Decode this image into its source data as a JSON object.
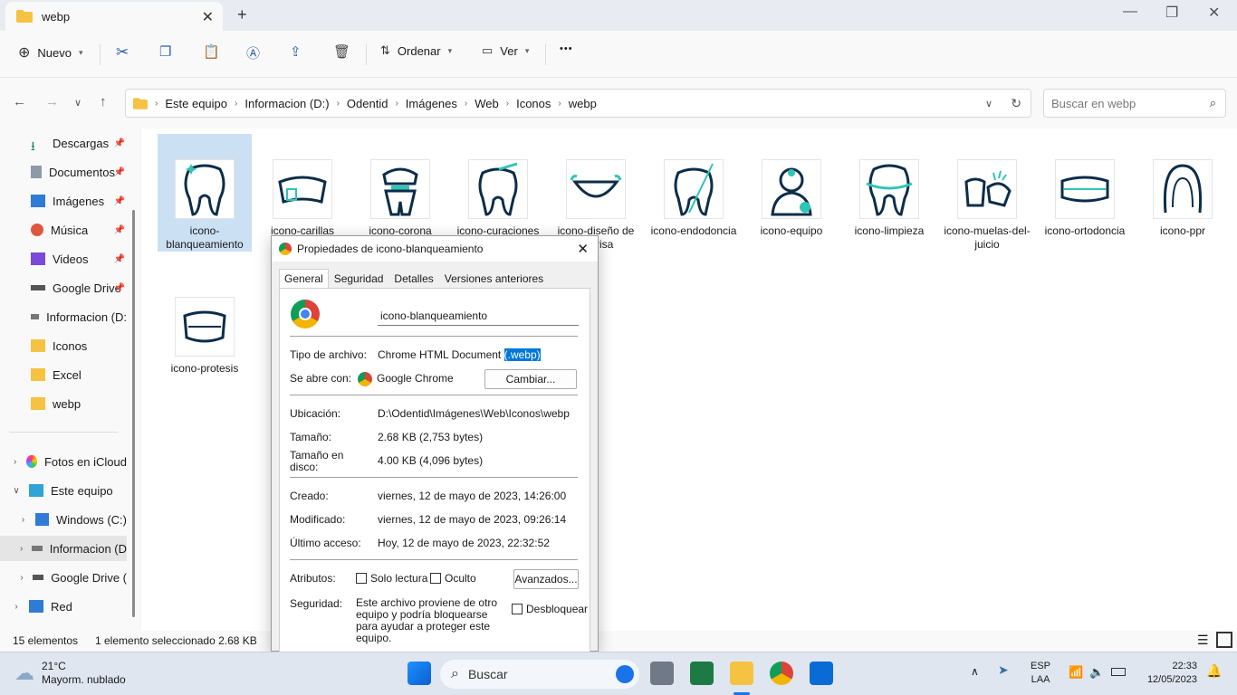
{
  "window": {
    "tab_title": "webp",
    "new_tab": "+",
    "minimize": "—",
    "maximize": "❐",
    "close": "✕"
  },
  "toolbar": {
    "new_label": "Nuevo",
    "sort_label": "Ordenar",
    "view_label": "Ver",
    "more_label": "•••"
  },
  "address": {
    "crumbs": [
      "Este equipo",
      "Informacion (D:)",
      "Odentid",
      "Imágenes",
      "Web",
      "Iconos",
      "webp"
    ],
    "search_placeholder": "Buscar en webp"
  },
  "sidebar": {
    "quick": [
      {
        "label": "Descargas"
      },
      {
        "label": "Documentos"
      },
      {
        "label": "Imágenes"
      },
      {
        "label": "Música"
      },
      {
        "label": "Videos"
      },
      {
        "label": "Google Drive"
      },
      {
        "label": "Informacion (D:"
      },
      {
        "label": "Iconos"
      },
      {
        "label": "Excel"
      },
      {
        "label": "webp"
      }
    ],
    "tree": [
      {
        "label": "Fotos en iCloud"
      },
      {
        "label": "Este equipo"
      },
      {
        "label": "Windows (C:)"
      },
      {
        "label": "Informacion (D"
      },
      {
        "label": "Google Drive ("
      },
      {
        "label": "Red"
      }
    ]
  },
  "files": [
    {
      "name": "icono-blanqueamiento"
    },
    {
      "name": "icono-carillas"
    },
    {
      "name": "icono-corona"
    },
    {
      "name": "icono-curaciones"
    },
    {
      "name": "icono-diseño de sonrisa"
    },
    {
      "name": "icono-endodoncia"
    },
    {
      "name": "icono-equipo"
    },
    {
      "name": "icono-limpieza"
    },
    {
      "name": "icono-muelas-del-juicio"
    },
    {
      "name": "icono-ortodoncia"
    },
    {
      "name": "icono-ppr"
    },
    {
      "name": "icono-protesis"
    }
  ],
  "status": {
    "count": "15 elementos",
    "selection": "1 elemento seleccionado  2.68 KB"
  },
  "dialog": {
    "title": "Propiedades de icono-blanqueamiento",
    "tabs": [
      "General",
      "Seguridad",
      "Detalles",
      "Versiones anteriores"
    ],
    "file_name": "icono-blanqueamiento",
    "type_label": "Tipo de archivo:",
    "type_value": "Chrome HTML Document",
    "type_ext": "(.webp)",
    "opens_label": "Se abre con:",
    "opens_value": "Google Chrome",
    "change_button": "Cambiar...",
    "location_label": "Ubicación:",
    "location_value": "D:\\Odentid\\Imágenes\\Web\\Iconos\\webp",
    "size_label": "Tamaño:",
    "size_value": "2.68 KB (2,753 bytes)",
    "disk_label_1": "Tamaño en",
    "disk_label_2": "disco:",
    "disk_value": "4.00 KB (4,096 bytes)",
    "created_label": "Creado:",
    "created_value": "viernes, 12 de mayo de 2023, 14:26:00",
    "modified_label": "Modificado:",
    "modified_value": "viernes, 12 de mayo de 2023, 09:26:14",
    "accessed_label": "Último acceso:",
    "accessed_value": "Hoy, 12 de mayo de 2023, 22:32:52",
    "attributes_label": "Atributos:",
    "readonly_label": "Solo lectura",
    "hidden_label": "Oculto",
    "advanced_button": "Avanzados...",
    "security_label": "Seguridad:",
    "security_text": "Este archivo proviene de otro equipo y podría bloquearse para ayudar a proteger este equipo.",
    "unblock_label": "Desbloquear"
  },
  "taskbar": {
    "temperature": "21°C",
    "weather": "Mayorm. nublado",
    "search_label": "Buscar",
    "lang": "ESP",
    "layout": "LAA",
    "time": "22:33",
    "date": "12/05/2023"
  }
}
